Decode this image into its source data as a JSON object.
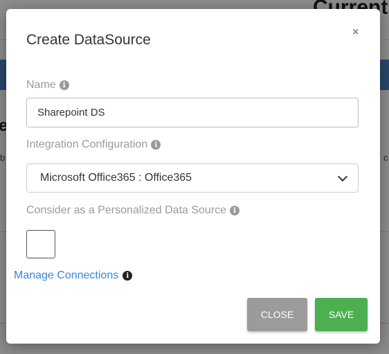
{
  "background": {
    "title_fragment": "Current",
    "left_letter": "e",
    "left_fragment": "b",
    "right_fragment": "c"
  },
  "modal": {
    "title": "Create DataSource",
    "close_glyph": "×",
    "name": {
      "label": "Name",
      "value": "Sharepoint DS"
    },
    "integration": {
      "label": "Integration Configuration",
      "selected": "Microsoft Office365 : Office365"
    },
    "personalized": {
      "label": "Consider as a Personalized Data Source",
      "checked": false
    },
    "manage_link": "Manage Connections",
    "info_glyph": "i",
    "buttons": {
      "close": "CLOSE",
      "save": "SAVE"
    }
  },
  "colors": {
    "accent_link": "#3a86d8",
    "save_button": "#4caf50",
    "close_button": "#9b9b9b",
    "header_bar": "#4a82c4"
  },
  "icons": [
    "info-icon",
    "chevron-down-icon",
    "close-icon"
  ]
}
